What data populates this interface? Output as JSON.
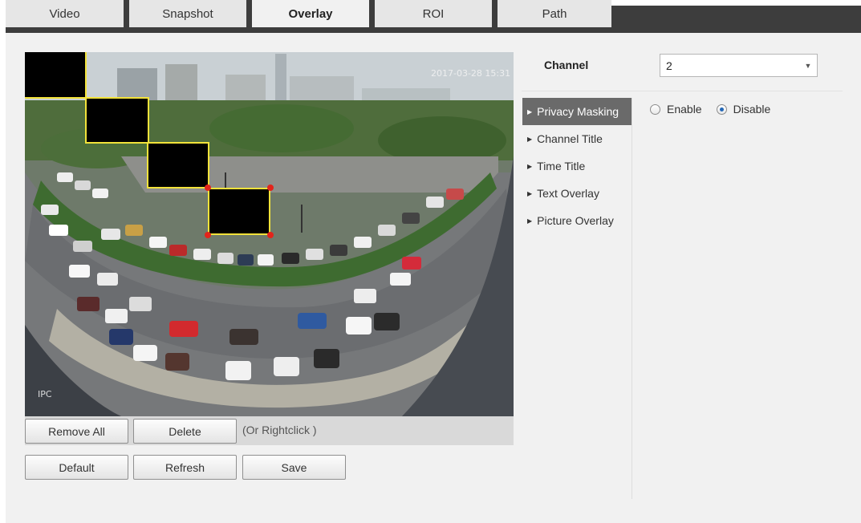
{
  "tabs": [
    {
      "label": "Video",
      "active": false
    },
    {
      "label": "Snapshot",
      "active": false
    },
    {
      "label": "Overlay",
      "active": true
    },
    {
      "label": "ROI",
      "active": false
    },
    {
      "label": "Path",
      "active": false
    }
  ],
  "preview": {
    "osd_datetime": "2017-03-28 15:31",
    "osd_channel_label": "IPC",
    "privacy_masks": 4
  },
  "preview_actions": {
    "remove_all": "Remove All",
    "delete": "Delete",
    "hint": "(Or Rightclick )"
  },
  "footer": {
    "default": "Default",
    "refresh": "Refresh",
    "save": "Save"
  },
  "channel": {
    "label": "Channel",
    "value": "2"
  },
  "menu": [
    {
      "label": "Privacy Masking",
      "active": true
    },
    {
      "label": "Channel Title",
      "active": false
    },
    {
      "label": "Time Title",
      "active": false
    },
    {
      "label": "Text Overlay",
      "active": false
    },
    {
      "label": "Picture Overlay",
      "active": false
    }
  ],
  "privacy_masking": {
    "enable_label": "Enable",
    "disable_label": "Disable",
    "selected": "disable"
  },
  "colors": {
    "tabbar": "#3d3d3d",
    "active_menu": "#6a6a6a",
    "mask_border": "#f2e23a",
    "handle": "#e3241b",
    "radio_dot": "#2468b6"
  },
  "icons": {
    "dropdown": "chevron-down-icon",
    "menu_bullet": "triangle-right-icon"
  }
}
